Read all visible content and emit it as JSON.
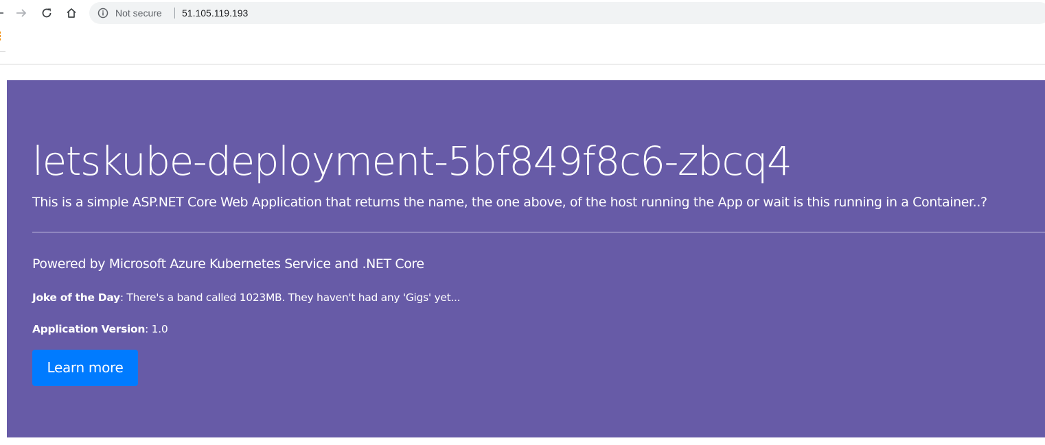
{
  "browser": {
    "security_label": "Not secure",
    "url": "51.105.119.193",
    "icons": {
      "back": "arrow-left-icon",
      "forward": "arrow-right-icon",
      "reload": "reload-icon",
      "home": "home-icon",
      "info": "info-icon",
      "apps": "apps-icon"
    }
  },
  "page": {
    "host_name": "letskube-deployment-5bf849f8c6-zbcq4",
    "lead": "This is a simple ASP.NET Core Web Application that returns the name, the one above, of the host running the App or wait is this running in a Container..?",
    "powered_by": "Powered by Microsoft Azure Kubernetes Service and .NET Core",
    "joke_label": "Joke of the Day",
    "joke_text": ": There's a band called 1023MB. They haven't had any 'Gigs' yet...",
    "version_label": "Application Version",
    "version_text": ": 1.0",
    "learn_more_label": "Learn more"
  },
  "colors": {
    "jumbotron_bg": "#675ba7",
    "button_bg": "#007bff",
    "text": "#ffffff"
  }
}
